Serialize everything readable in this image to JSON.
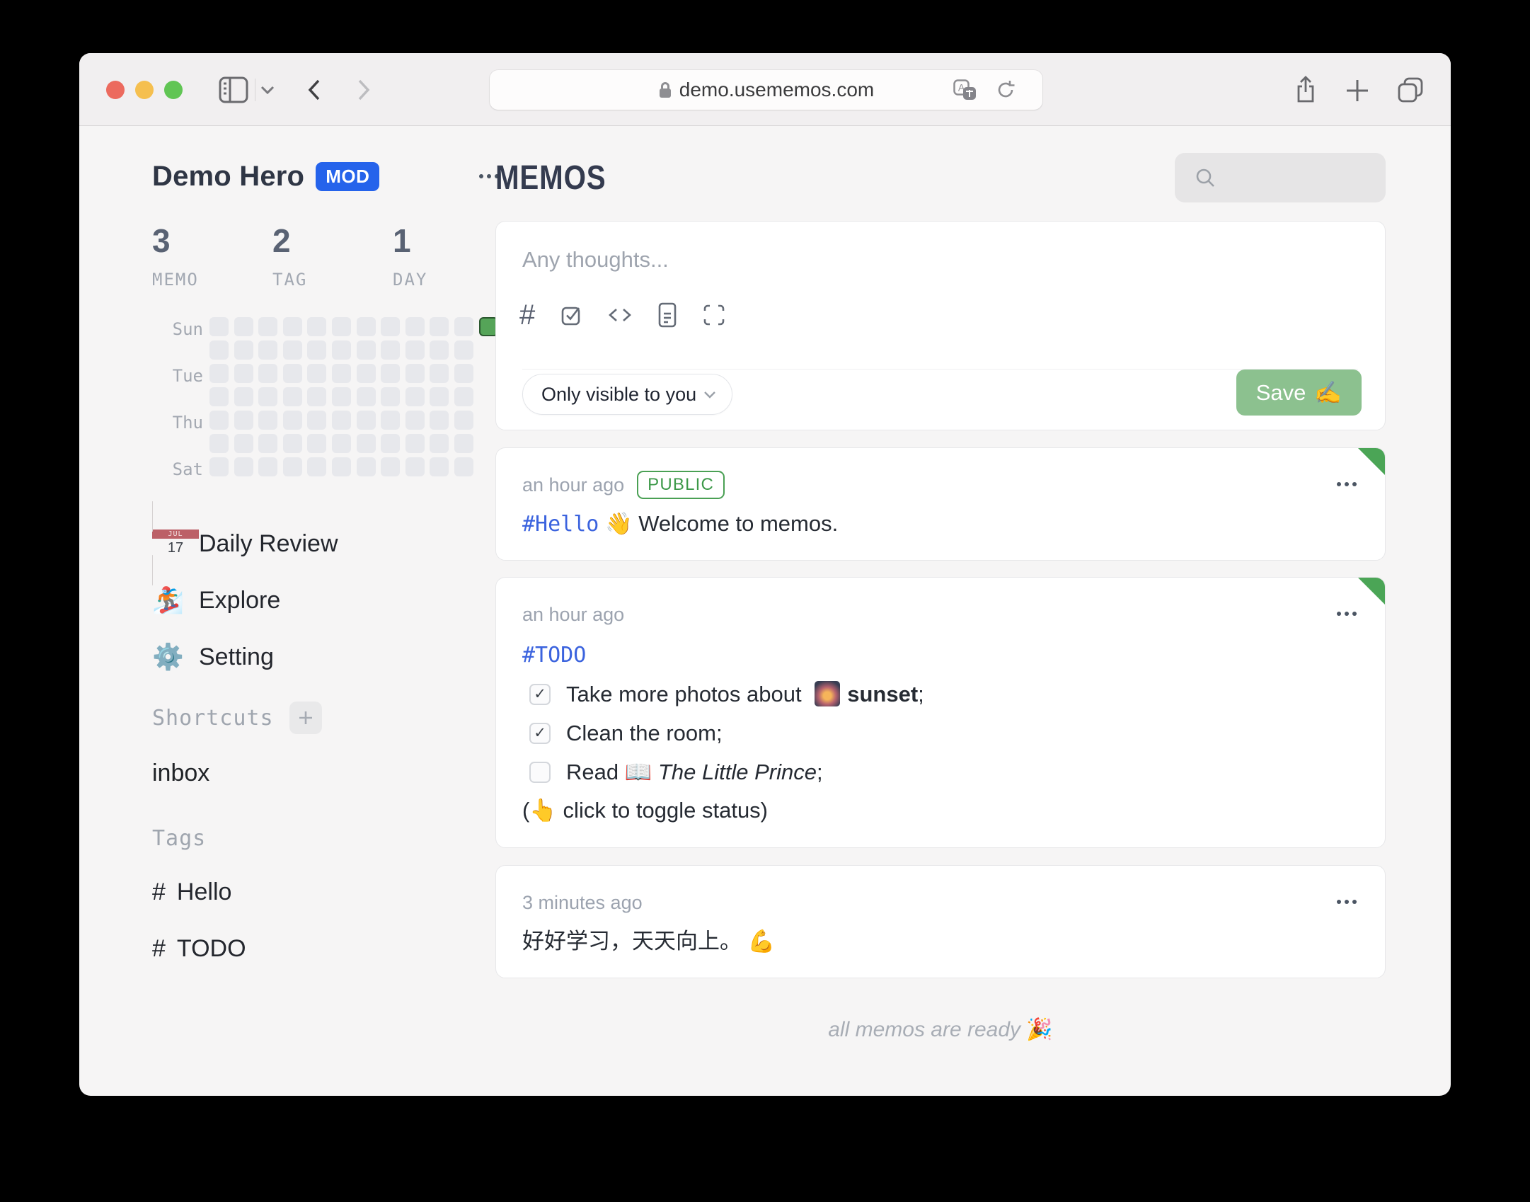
{
  "colors": {
    "accent_blue": "#2563EB",
    "tag_blue": "#3B63DE",
    "save_green": "#8CC18F",
    "badge_green": "#3D9949",
    "heat_green": "#55A458",
    "traffic_red": "#EC6A5E",
    "traffic_yellow": "#F5BF4F",
    "traffic_green": "#61C554"
  },
  "browser": {
    "url": "demo.usememos.com"
  },
  "sidebar": {
    "user": {
      "name": "Demo Hero",
      "badge": "MOD"
    },
    "stats": {
      "memo": {
        "value": "3",
        "label": "MEMO"
      },
      "tag": {
        "value": "2",
        "label": "TAG"
      },
      "day": {
        "value": "1",
        "label": "DAY"
      }
    },
    "heatmap": {
      "labels": [
        "Sun",
        "Tue",
        "Thu",
        "Sat"
      ],
      "rows": 7,
      "columns": 12,
      "last_column_cells": 1,
      "active": {
        "row": 0,
        "col": 11
      }
    },
    "nav": {
      "daily_review": {
        "label": "Daily Review",
        "icon_month": "JUL",
        "icon_day": "17"
      },
      "explore": {
        "label": "Explore",
        "emoji": "🏂"
      },
      "setting": {
        "label": "Setting",
        "emoji": "⚙️"
      }
    },
    "shortcuts": {
      "label": "Shortcuts",
      "item_inbox": "inbox"
    },
    "tags": {
      "label": "Tags",
      "items": [
        {
          "hash": "#",
          "name": "Hello"
        },
        {
          "hash": "#",
          "name": "TODO"
        }
      ]
    }
  },
  "main": {
    "title": "MEMOS",
    "editor": {
      "placeholder": "Any thoughts...",
      "visibility": "Only visible to you",
      "save_label": "Save",
      "save_emoji": "✍️"
    },
    "memo1": {
      "time": "an hour ago",
      "badge": "PUBLIC",
      "tag": "#Hello",
      "wave_emoji": "👋",
      "text": "Welcome to memos."
    },
    "memo2": {
      "time": "an hour ago",
      "tag": "#TODO",
      "tasks": {
        "t0": {
          "checked": true,
          "check": "✓",
          "before": "Take more photos about ",
          "image_emoji": "🌄",
          "bold": "sunset",
          "after": ";"
        },
        "t1": {
          "checked": true,
          "check": "✓",
          "text": "Clean the room;"
        },
        "t2": {
          "checked": false,
          "before": "Read ",
          "book_emoji": "📖",
          "italic": "The Little Prince",
          "after": ";"
        }
      },
      "toggle_open": "(",
      "toggle_emoji": "👆",
      "toggle_text": " click to toggle status)"
    },
    "memo3": {
      "time": "3 minutes ago",
      "text": "好好学习，天天向上。",
      "muscle_emoji": "💪"
    },
    "footer": "all memos are ready",
    "footer_emoji": "🎉"
  }
}
